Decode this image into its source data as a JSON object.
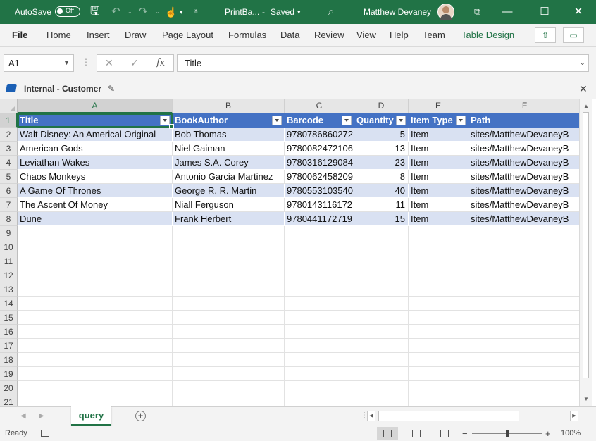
{
  "titlebar": {
    "autosave_label": "AutoSave",
    "autosave_state": "Off",
    "filename": "PrintBa...",
    "save_status": "Saved",
    "user_name": "Matthew Devaney"
  },
  "ribbon": {
    "tabs": [
      "File",
      "Home",
      "Insert",
      "Draw",
      "Page Layout",
      "Formulas",
      "Data",
      "Review",
      "View",
      "Help",
      "Team",
      "Table Design"
    ]
  },
  "formula_bar": {
    "name_box": "A1",
    "content": "Title"
  },
  "sensitivity": {
    "label": "Internal - Customer"
  },
  "grid": {
    "columns": [
      "A",
      "B",
      "C",
      "D",
      "E",
      "F"
    ],
    "row_numbers": [
      "1",
      "2",
      "3",
      "4",
      "5",
      "6",
      "7",
      "8",
      "9",
      "10",
      "11",
      "12",
      "13",
      "14",
      "15",
      "16",
      "17",
      "18",
      "19",
      "20",
      "21"
    ],
    "headers": [
      "Title",
      "BookAuthor",
      "Barcode",
      "Quantity",
      "Item Type",
      "Path"
    ],
    "rows": [
      [
        "Walt Disney: An Americal Original",
        "Bob Thomas",
        "9780786860272",
        "5",
        "Item",
        "sites/MatthewDevaneyB"
      ],
      [
        "American Gods",
        "Niel Gaiman",
        "9780082472106",
        "13",
        "Item",
        "sites/MatthewDevaneyB"
      ],
      [
        "Leviathan Wakes",
        "James S.A. Corey",
        "9780316129084",
        "23",
        "Item",
        "sites/MatthewDevaneyB"
      ],
      [
        "Chaos Monkeys",
        "Antonio Garcia Martinez",
        "9780062458209",
        "8",
        "Item",
        "sites/MatthewDevaneyB"
      ],
      [
        "A Game Of Thrones",
        "George R. R. Martin",
        "9780553103540",
        "40",
        "Item",
        "sites/MatthewDevaneyB"
      ],
      [
        "The Ascent Of Money",
        "Niall Ferguson",
        "9780143116172",
        "11",
        "Item",
        "sites/MatthewDevaneyB"
      ],
      [
        "Dune",
        "Frank Herbert",
        "9780441172719",
        "15",
        "Item",
        "sites/MatthewDevaneyB"
      ]
    ]
  },
  "sheets": {
    "active": "query"
  },
  "status": {
    "ready": "Ready",
    "zoom": "100%"
  },
  "colors": {
    "excel_green": "#217346",
    "table_header": "#4472c4",
    "table_band": "#d9e1f2"
  }
}
